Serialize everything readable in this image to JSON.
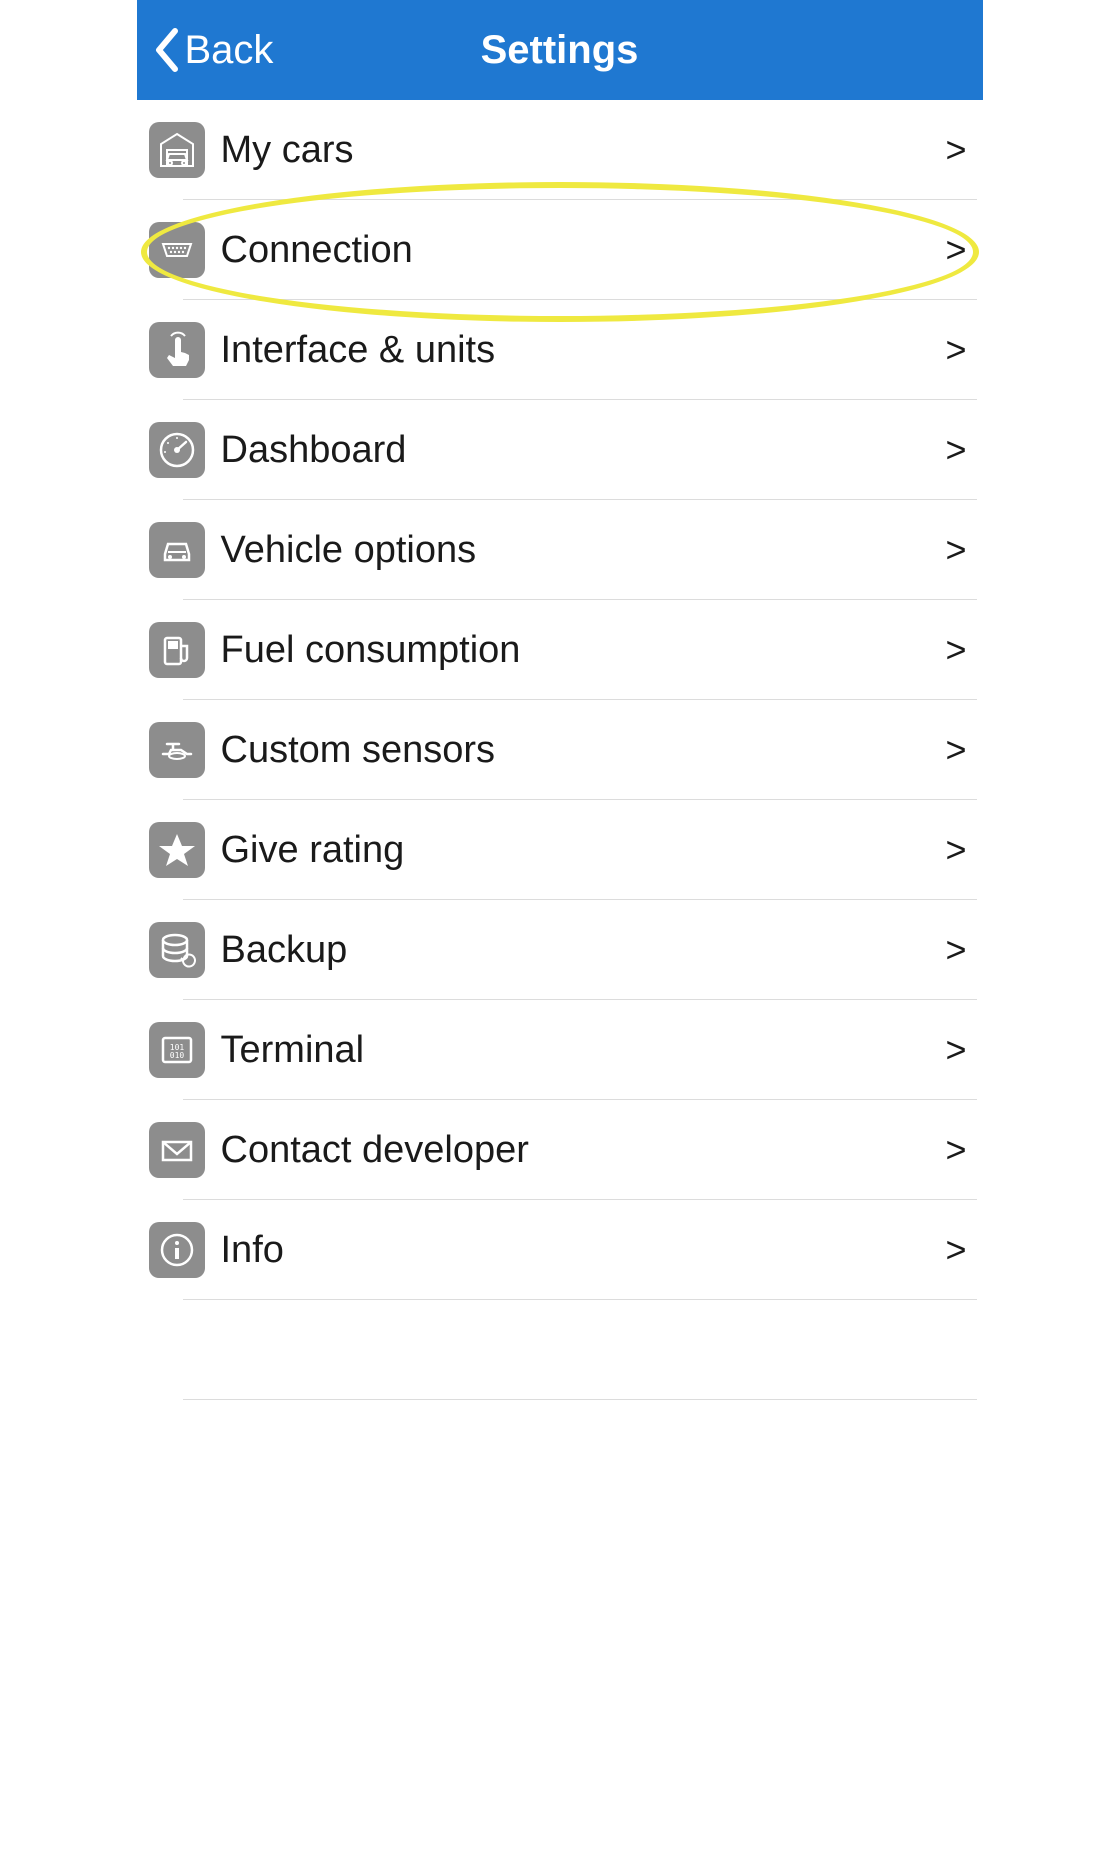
{
  "header": {
    "back_label": "Back",
    "title": "Settings"
  },
  "items": [
    {
      "id": "my-cars",
      "label": "My cars",
      "icon": "garage-icon"
    },
    {
      "id": "connection",
      "label": "Connection",
      "icon": "obd-icon"
    },
    {
      "id": "interface-units",
      "label": "Interface & units",
      "icon": "touch-icon"
    },
    {
      "id": "dashboard",
      "label": "Dashboard",
      "icon": "gauge-icon"
    },
    {
      "id": "vehicle-options",
      "label": "Vehicle options",
      "icon": "car-icon"
    },
    {
      "id": "fuel-consumption",
      "label": "Fuel consumption",
      "icon": "fuel-icon"
    },
    {
      "id": "custom-sensors",
      "label": "Custom sensors",
      "icon": "sensor-icon"
    },
    {
      "id": "give-rating",
      "label": "Give rating",
      "icon": "star-icon"
    },
    {
      "id": "backup",
      "label": "Backup",
      "icon": "backup-icon"
    },
    {
      "id": "terminal",
      "label": "Terminal",
      "icon": "terminal-icon"
    },
    {
      "id": "contact-developer",
      "label": "Contact developer",
      "icon": "mail-icon"
    },
    {
      "id": "info",
      "label": "Info",
      "icon": "info-icon"
    }
  ],
  "highlighted_item_index": 1
}
